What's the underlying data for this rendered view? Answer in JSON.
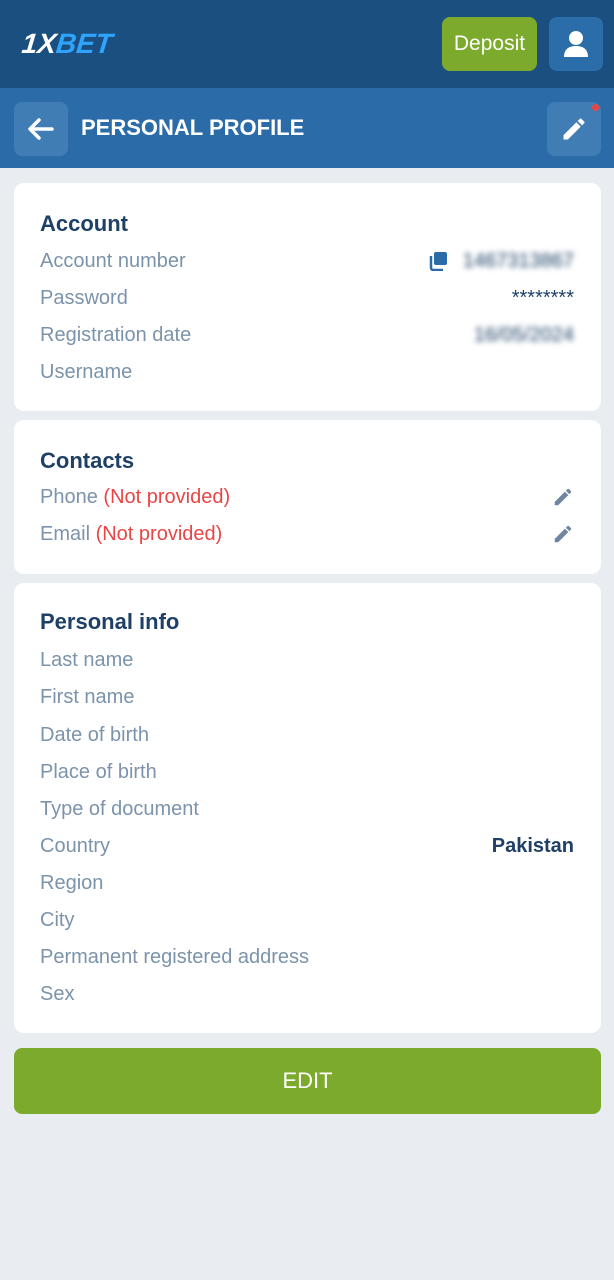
{
  "app": {
    "logo_part1": "1X",
    "logo_part2": "BET",
    "deposit_label": "Deposit"
  },
  "header": {
    "title": "PERSONAL PROFILE"
  },
  "account": {
    "title": "Account",
    "rows": [
      {
        "label": "Account number",
        "value": "1467313867"
      },
      {
        "label": "Password",
        "value": "********"
      },
      {
        "label": "Registration date",
        "value": "16/05/2024"
      },
      {
        "label": "Username",
        "value": ""
      }
    ]
  },
  "contacts": {
    "title": "Contacts",
    "rows": [
      {
        "label": "Phone",
        "status": "(Not provided)"
      },
      {
        "label": "Email",
        "status": "(Not provided)"
      }
    ]
  },
  "personal": {
    "title": "Personal info",
    "rows": [
      {
        "label": "Last name",
        "value": ""
      },
      {
        "label": "First name",
        "value": ""
      },
      {
        "label": "Date of birth",
        "value": ""
      },
      {
        "label": "Place of birth",
        "value": ""
      },
      {
        "label": "Type of document",
        "value": ""
      },
      {
        "label": "Country",
        "value": "Pakistan"
      },
      {
        "label": "Region",
        "value": ""
      },
      {
        "label": "City",
        "value": ""
      },
      {
        "label": "Permanent registered address",
        "value": ""
      },
      {
        "label": "Sex",
        "value": ""
      }
    ]
  },
  "footer": {
    "edit_label": "EDIT"
  },
  "icons": {
    "profile": "user-icon",
    "back": "arrow-left-icon",
    "edit": "pencil-icon",
    "copy": "copy-icon"
  },
  "colors": {
    "topbar": "#1b4f7f",
    "header": "#2b6ca8",
    "accent_green": "#7caa2c",
    "warning_red": "#e84646",
    "title_text": "#1e4066",
    "label_text": "#7b93ab"
  }
}
